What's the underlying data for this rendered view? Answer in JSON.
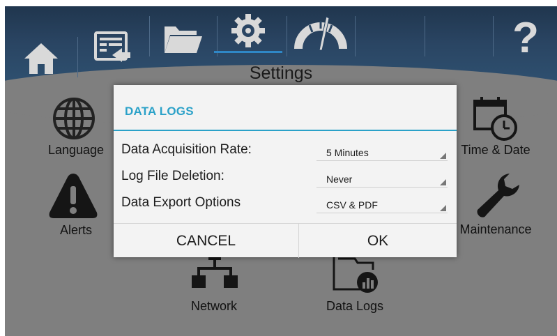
{
  "page": {
    "title": "Settings"
  },
  "nav": {
    "items": [
      {
        "name": "home"
      },
      {
        "name": "display"
      },
      {
        "name": "folder"
      },
      {
        "name": "settings"
      },
      {
        "name": "gauge"
      },
      {
        "name": "empty"
      },
      {
        "name": "help",
        "glyph": "?"
      }
    ]
  },
  "tiles": {
    "language": "Language",
    "alerts": "Alerts",
    "network": "Network",
    "data_logs": "Data Logs",
    "time_date": "Time & Date",
    "maintenance": "Maintenance"
  },
  "dialog": {
    "title": "DATA LOGS",
    "rows": [
      {
        "label": "Data Acquisition Rate:",
        "value": "5 Minutes"
      },
      {
        "label": "Log File Deletion:",
        "value": "Never"
      },
      {
        "label": "Data Export Options",
        "value": "CSV & PDF"
      }
    ],
    "cancel_label": "CANCEL",
    "ok_label": "OK"
  },
  "colors": {
    "accent": "#2aa1c8",
    "nav_bg": "#2a4563",
    "screen_bg": "#7f7f7f",
    "dialog_bg": "#f3f3f3"
  }
}
